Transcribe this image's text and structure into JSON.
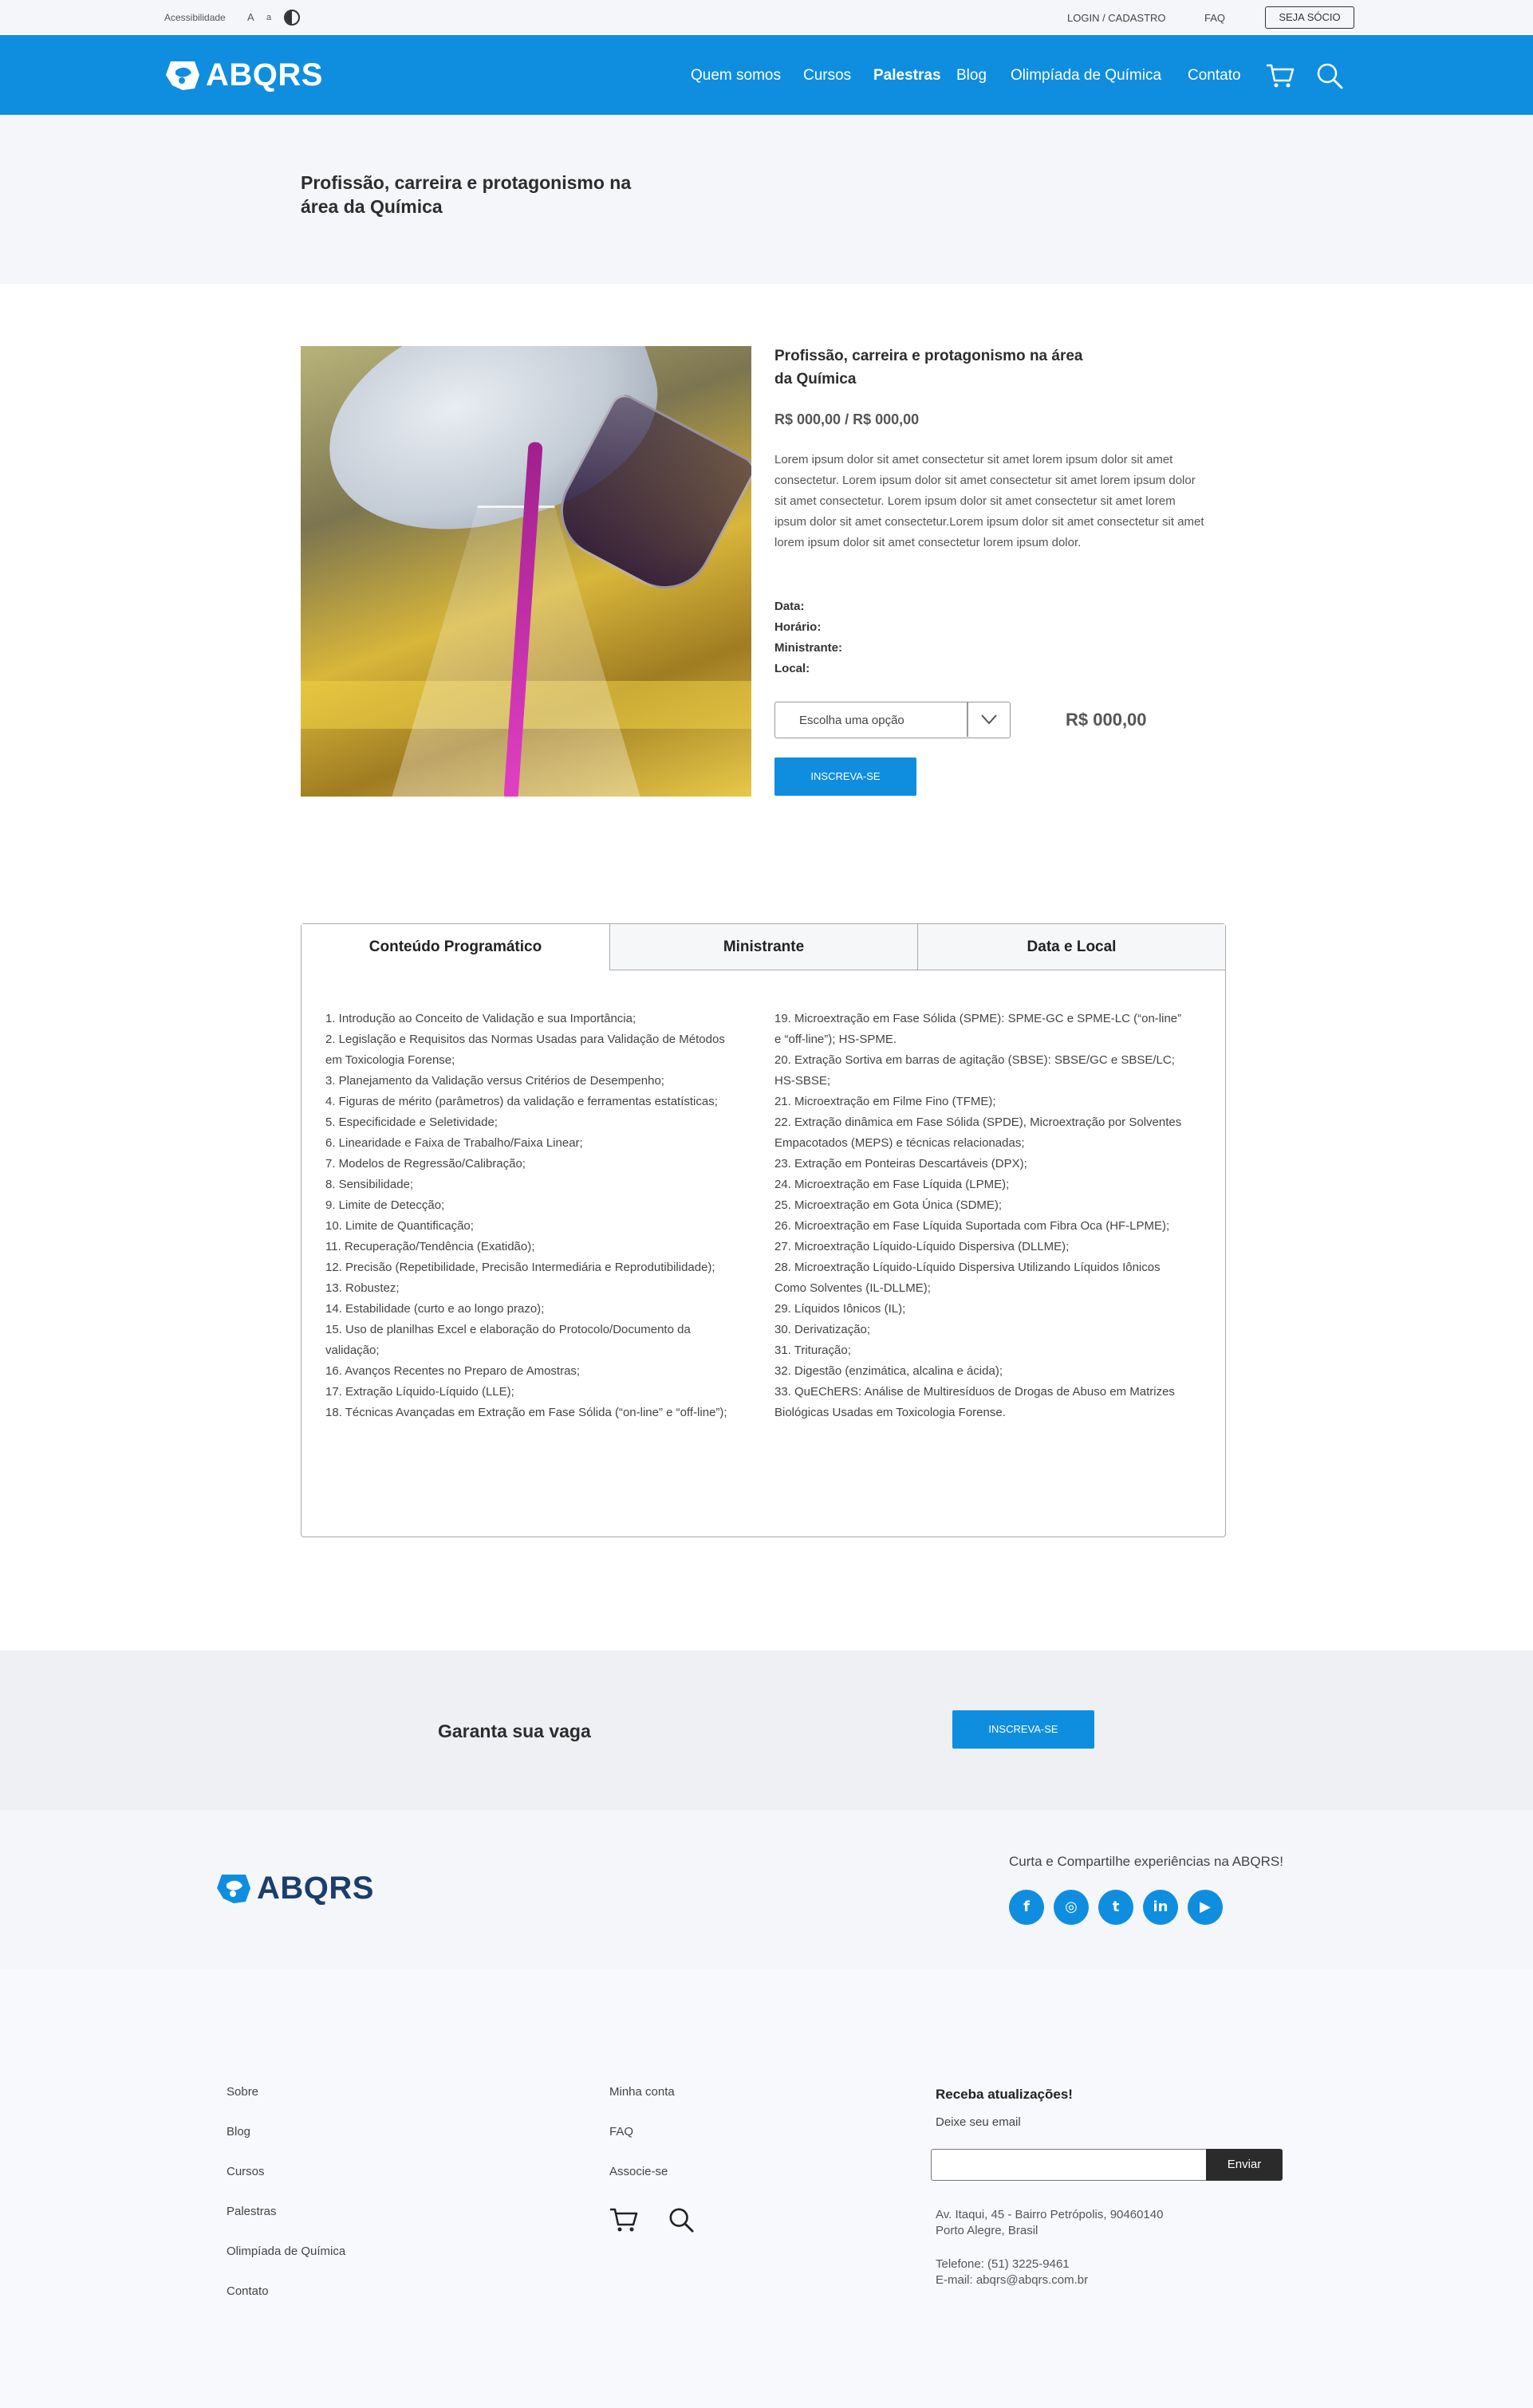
{
  "util": {
    "accessibility": "Acessibilidade",
    "font_large": "A",
    "font_small": "a",
    "login": "LOGIN / CADASTRO",
    "faq": "FAQ",
    "member": "SEJA SÓCIO"
  },
  "brand": {
    "name": "ABQRS",
    "color": "#0f8ee0"
  },
  "nav": [
    "Quem somos",
    "Cursos",
    "Palestras",
    "Blog",
    "Olimpíada de Química",
    "Contato"
  ],
  "hero": {
    "title": "Profissão, carreira e protagonismo na área da Química"
  },
  "product": {
    "title": "Profissão, carreira e protagonismo na área da Química",
    "price": "R$ 000,00 / R$ 000,00",
    "description": "Lorem ipsum dolor sit amet consectetur sit amet lorem ipsum dolor sit amet consectetur. Lorem ipsum dolor sit amet consectetur sit amet lorem ipsum dolor sit amet consectetur. Lorem ipsum dolor sit amet consectetur sit amet lorem ipsum dolor sit amet consectetur.Lorem ipsum dolor sit amet consectetur sit amet lorem ipsum dolor sit amet consectetur  lorem ipsum dolor.",
    "meta": {
      "date": "Data:",
      "time": "Horário:",
      "speaker": "Ministrante:",
      "place": "Local:"
    },
    "select_placeholder": "Escolha uma opção",
    "total": "R$ 000,00",
    "cta": "INSCREVA-SE"
  },
  "tabs": {
    "labels": [
      "Conteúdo Programático",
      "Ministrante",
      "Data e Local"
    ],
    "active": 0,
    "col1": [
      "1. Introdução ao Conceito de Validação e sua Importância;",
      "2. Legislação e Requisitos das Normas Usadas para Validação de Métodos em Toxicologia Forense;",
      "3. Planejamento da Validação versus Critérios de Desempenho;",
      "4. Figuras de mérito (parâmetros) da validação e ferramentas estatísticas;",
      "5. Especificidade e Seletividade;",
      "6. Linearidade e Faixa de Trabalho/Faixa Linear;",
      "7. Modelos de Regressão/Calibração;",
      "8. Sensibilidade;",
      "9. Limite de Detecção;",
      "10. Limite de Quantificação;",
      "11. Recuperação/Tendência (Exatidão);",
      "12. Precisão (Repetibilidade, Precisão Intermediária e Reprodutibilidade);",
      "13. Robustez;",
      "14. Estabilidade (curto e ao longo prazo);",
      "15. Uso de planilhas Excel e elaboração do Protocolo/Documento da validação;",
      "16. Avanços Recentes no Preparo de Amostras;",
      "17. Extração Líquido-Líquido (LLE);",
      "18. Técnicas Avançadas em Extração em Fase Sólida (“on-line” e “off-line”);"
    ],
    "col2": [
      "19. Microextração em Fase Sólida (SPME): SPME-GC e SPME-LC (“on-line” e “off-line”); HS-SPME.",
      "20. Extração Sortiva em barras de agitação (SBSE): SBSE/GC e SBSE/LC; HS-SBSE;",
      "21. Microextração em Filme Fino (TFME);",
      "22. Extração dinâmica em Fase Sólida (SPDE), Microextração por Solventes Empacotados (MEPS) e técnicas relacionadas;",
      "23. Extração em Ponteiras Descartáveis (DPX);",
      "24. Microextração em Fase Líquida (LPME);",
      "25. Microextração em Gota Única (SDME);",
      "26. Microextração em Fase Líquida Suportada com Fibra Oca (HF-LPME);",
      "27. Microextração Líquido-Líquido Dispersiva (DLLME);",
      "28. Microextração Líquido-Líquido Dispersiva Utilizando Líquidos Iônicos Como Solventes (IL-DLLME);",
      "29. Líquidos Iônicos (IL);",
      "30. Derivatização;",
      "31. Trituração;",
      "32. Digestão (enzimática, alcalina e ácida);",
      "33. QuEChERS: Análise de Multiresíduos de Drogas de Abuso em Matrizes Biológicas Usadas em Toxicologia Forense."
    ]
  },
  "cta": {
    "title": "Garanta sua vaga",
    "button": "INSCREVA-SE"
  },
  "footer": {
    "share": "Curta e Compartilhe experiências na ABQRS!",
    "socials": [
      "facebook-icon",
      "instagram-icon",
      "twitter-icon",
      "linkedin-icon",
      "youtube-icon"
    ],
    "social_glyphs": [
      "f",
      "◎",
      "t",
      "in",
      "▶"
    ],
    "col1": [
      "Sobre",
      "Blog",
      "Cursos",
      "Palestras",
      "Olimpíada de Química",
      "Contato"
    ],
    "col2": [
      "Minha conta",
      "FAQ",
      "Associe-se"
    ],
    "newsletter_title": "Receba atualizações!",
    "newsletter_sub": "Deixe seu email",
    "email_placeholder": "",
    "send": "Enviar",
    "address_1": "Av. Itaqui, 45 - Bairro Petrópolis, 90460140",
    "address_2": "Porto Alegre, Brasil",
    "phone": "Telefone: (51) 3225-9461",
    "email": "E-mail: abqrs@abqrs.com.br"
  }
}
